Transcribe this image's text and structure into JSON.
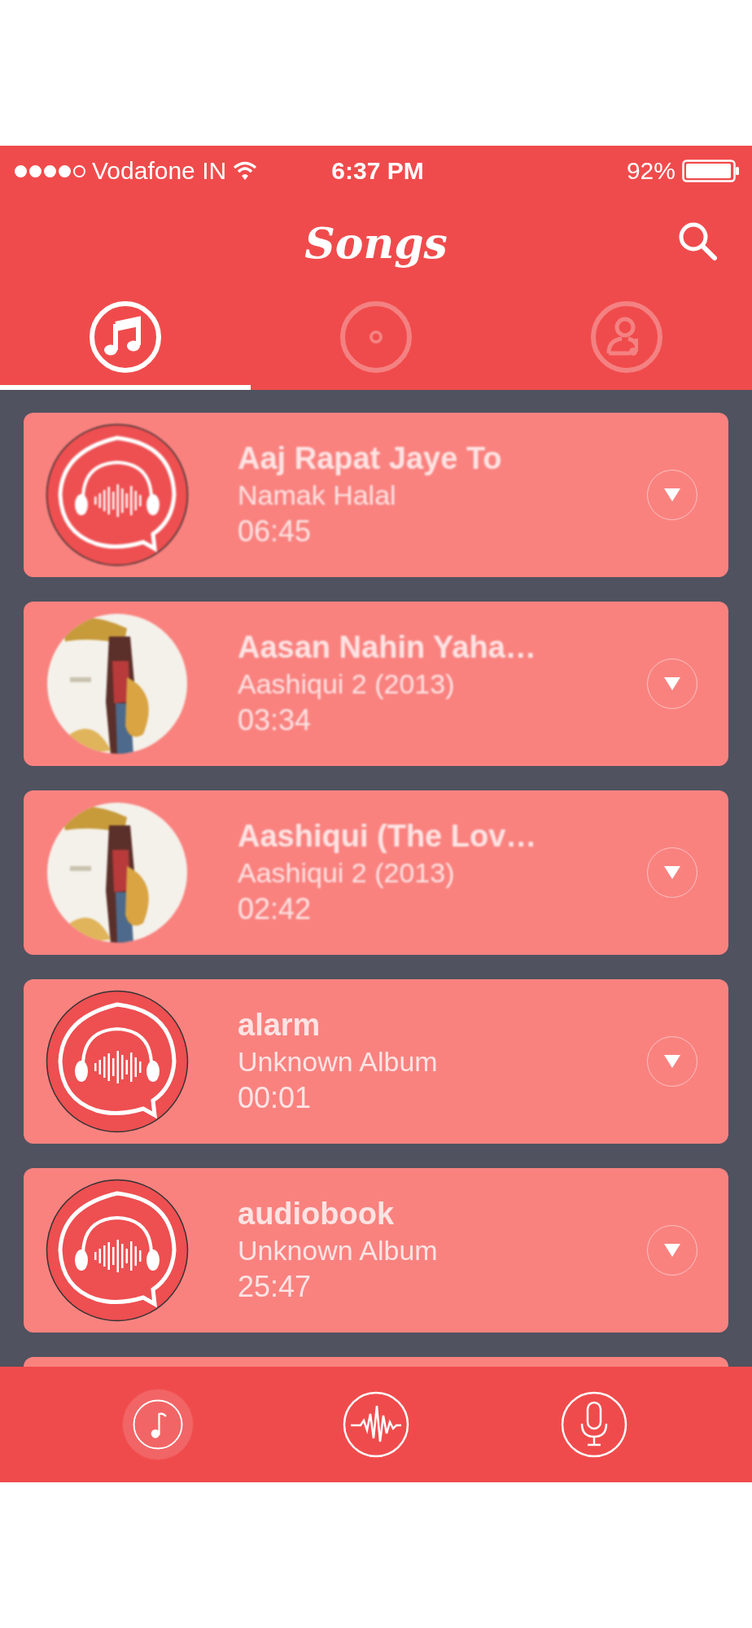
{
  "status_bar": {
    "signal_dots": [
      {
        "filled": true
      },
      {
        "filled": true
      },
      {
        "filled": true
      },
      {
        "filled": true
      },
      {
        "filled": false
      }
    ],
    "carrier": "Vodafone IN",
    "time": "6:37 PM",
    "battery": "92%"
  },
  "header": {
    "title": "Songs"
  },
  "tabs": [
    {
      "kind": "songs",
      "selected": true
    },
    {
      "kind": "albums",
      "selected": false
    },
    {
      "kind": "artists",
      "selected": false
    }
  ],
  "songs": [
    {
      "title": "Aaj Rapat Jaye To",
      "album": "Namak Halal",
      "duration": "06:45",
      "kind": "headphones",
      "blurred": true
    },
    {
      "title": "Aasan Nahin Yaha…",
      "album": "Aashiqui 2 (2013)",
      "duration": "03:34",
      "kind": "picture",
      "blurred": true
    },
    {
      "title": "Aashiqui (The Lov…",
      "album": "Aashiqui 2 (2013)",
      "duration": "02:42",
      "kind": "picture",
      "blurred": true
    },
    {
      "title": "alarm",
      "album": "Unknown Album",
      "duration": "00:01",
      "kind": "headphones",
      "blurred": false
    },
    {
      "title": "audiobook",
      "album": "Unknown Album",
      "duration": "25:47",
      "kind": "headphones",
      "blurred": false
    }
  ],
  "bottom_nav": [
    {
      "kind": "music",
      "selected": true
    },
    {
      "kind": "waveform",
      "selected": false
    },
    {
      "kind": "microphone",
      "selected": false
    }
  ]
}
